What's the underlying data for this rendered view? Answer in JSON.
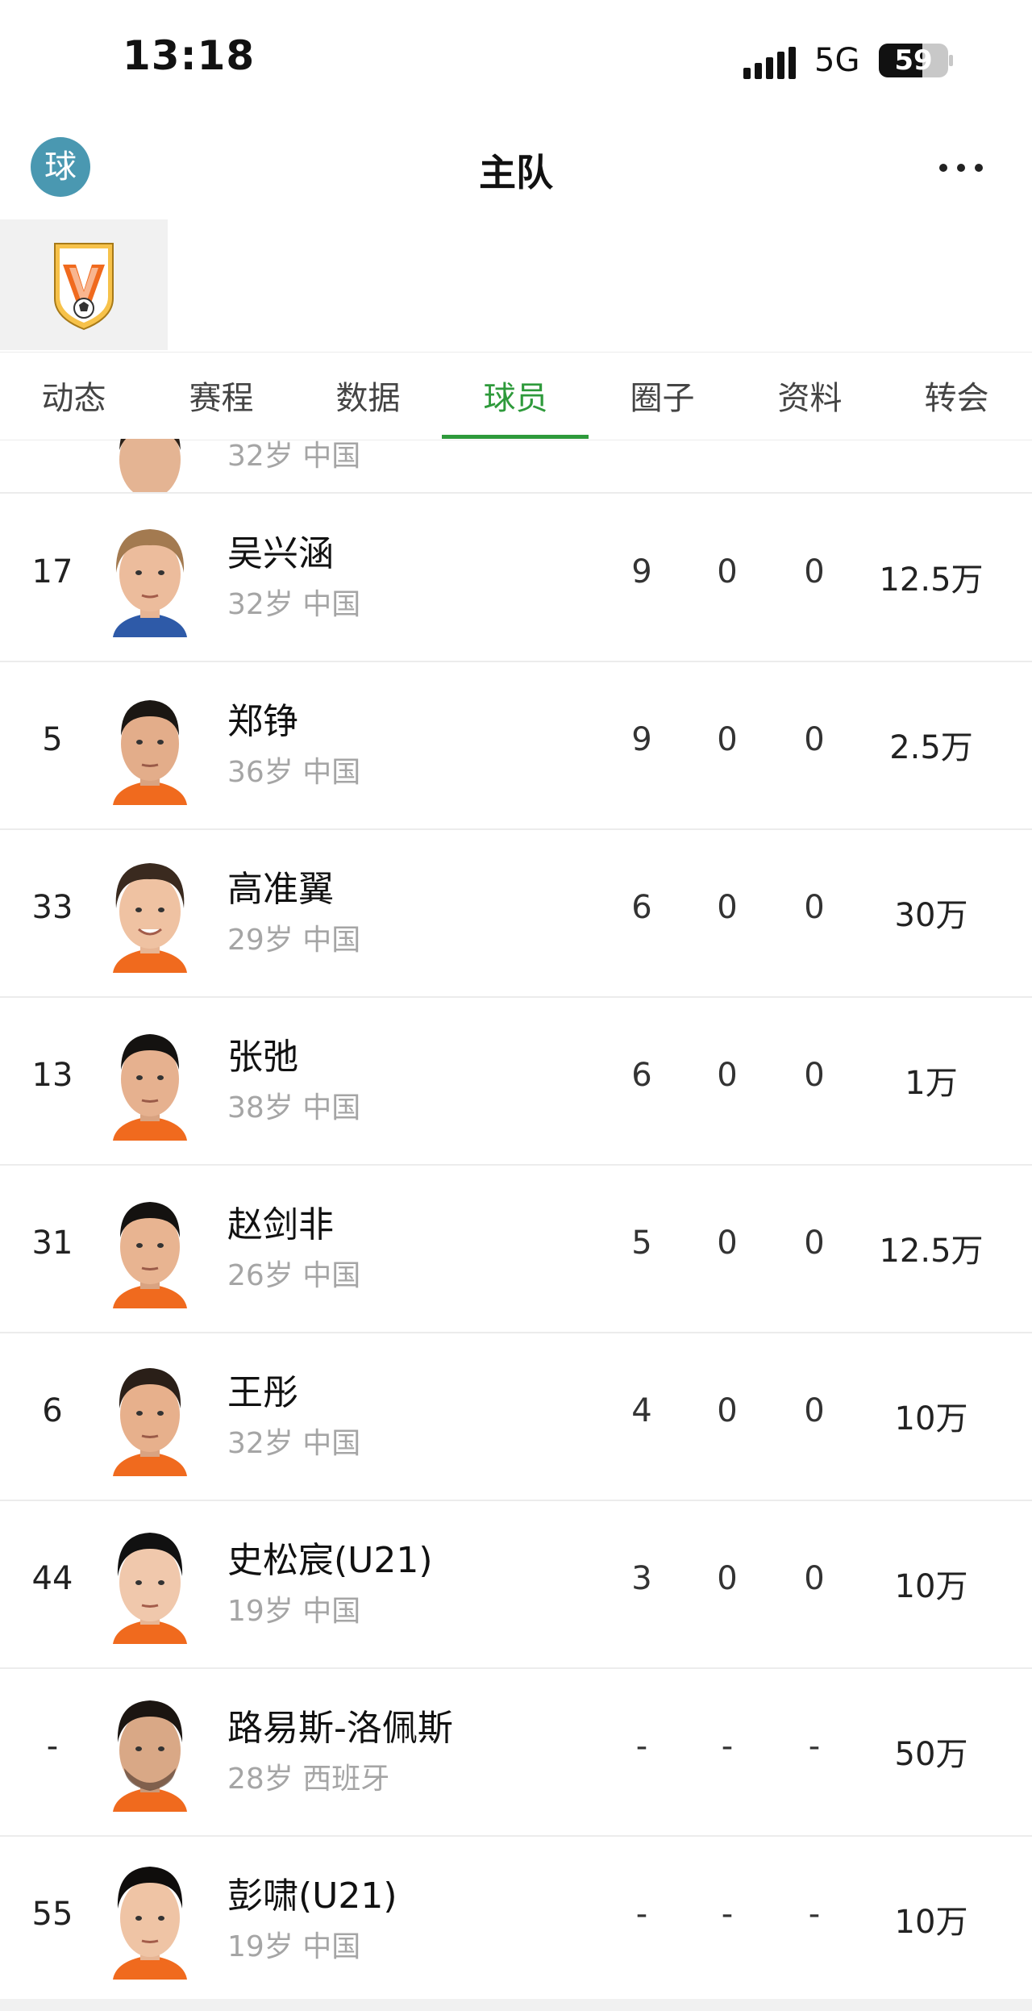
{
  "status_bar": {
    "time": "13:18",
    "network": "5G",
    "battery": "59"
  },
  "header": {
    "app_icon_char": "球",
    "title": "主队"
  },
  "tabs": [
    {
      "label": "动态"
    },
    {
      "label": "赛程"
    },
    {
      "label": "数据"
    },
    {
      "label": "球员"
    },
    {
      "label": "圈子"
    },
    {
      "label": "资料"
    },
    {
      "label": "转会"
    }
  ],
  "active_tab": 3,
  "partial_row": {
    "sub": "32岁 中国"
  },
  "players": [
    {
      "number": "17",
      "name": "吴兴涵",
      "age_country": "32岁 中国",
      "s1": "9",
      "s2": "0",
      "s3": "0",
      "value": "12.5万"
    },
    {
      "number": "5",
      "name": "郑铮",
      "age_country": "36岁 中国",
      "s1": "9",
      "s2": "0",
      "s3": "0",
      "value": "2.5万"
    },
    {
      "number": "33",
      "name": "高准翼",
      "age_country": "29岁 中国",
      "s1": "6",
      "s2": "0",
      "s3": "0",
      "value": "30万"
    },
    {
      "number": "13",
      "name": "张弛",
      "age_country": "38岁 中国",
      "s1": "6",
      "s2": "0",
      "s3": "0",
      "value": "1万"
    },
    {
      "number": "31",
      "name": "赵剑非",
      "age_country": "26岁 中国",
      "s1": "5",
      "s2": "0",
      "s3": "0",
      "value": "12.5万"
    },
    {
      "number": "6",
      "name": "王彤",
      "age_country": "32岁 中国",
      "s1": "4",
      "s2": "0",
      "s3": "0",
      "value": "10万"
    },
    {
      "number": "44",
      "name": "史松宸(U21)",
      "age_country": "19岁 中国",
      "s1": "3",
      "s2": "0",
      "s3": "0",
      "value": "10万"
    },
    {
      "number": "-",
      "name": "路易斯-洛佩斯",
      "age_country": "28岁 西班牙",
      "s1": "-",
      "s2": "-",
      "s3": "-",
      "value": "50万"
    },
    {
      "number": "55",
      "name": "彭啸(U21)",
      "age_country": "19岁 中国",
      "s1": "-",
      "s2": "-",
      "s3": "-",
      "value": "10万"
    }
  ],
  "colors": {
    "accent": "#2e9a3b",
    "app_icon": "#4a98b1",
    "logo_orange": "#f06a1e"
  }
}
